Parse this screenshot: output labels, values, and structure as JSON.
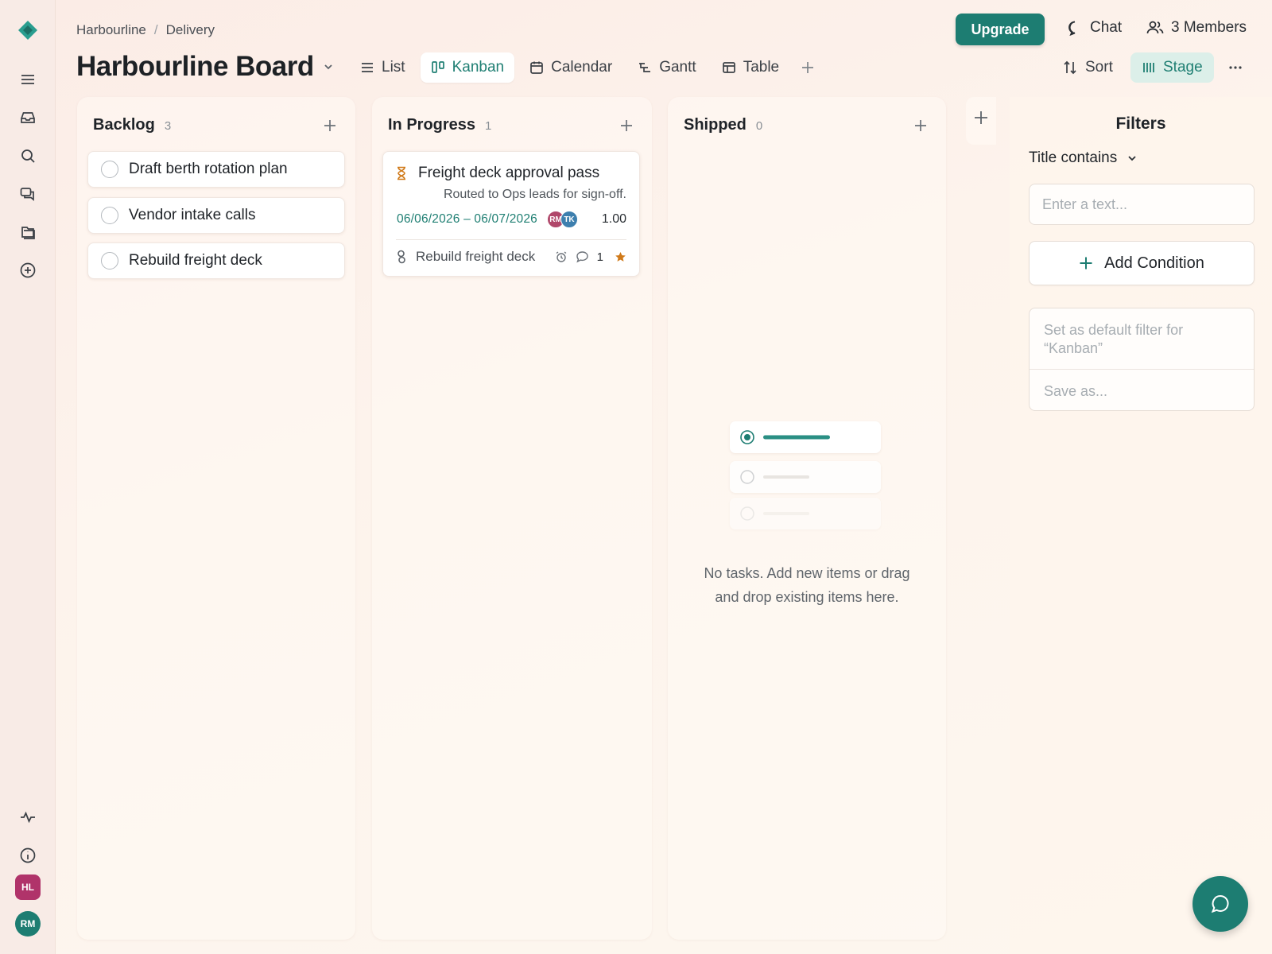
{
  "breadcrumb": {
    "workspace": "Harbourline",
    "separator": "/",
    "page": "Delivery"
  },
  "board": {
    "title": "Harbourline Board"
  },
  "views": [
    {
      "label": "List",
      "icon": "list-icon"
    },
    {
      "label": "Kanban",
      "icon": "kanban-icon",
      "active": true
    },
    {
      "label": "Calendar",
      "icon": "calendar-icon"
    },
    {
      "label": "Gantt",
      "icon": "gantt-icon"
    },
    {
      "label": "Table",
      "icon": "table-icon"
    }
  ],
  "header": {
    "upgrade_label": "Upgrade",
    "chat_label": "Chat",
    "members_label": "3 Members",
    "sort_label": "Sort",
    "stage_label": "Stage"
  },
  "sidebar": {
    "avatars": [
      {
        "initials": "HL",
        "color": "#b0336a"
      },
      {
        "initials": "RM",
        "color": "#1d7d72"
      }
    ]
  },
  "columns": [
    {
      "title": "Backlog",
      "count": "3",
      "tasks": [
        {
          "title": "Draft berth rotation plan"
        },
        {
          "title": "Vendor intake calls"
        },
        {
          "title": "Rebuild freight deck"
        }
      ]
    },
    {
      "title": "In Progress",
      "count": "1",
      "task": {
        "title": "Freight deck approval pass",
        "description": "Routed to Ops leads for sign-off.",
        "date_range": "06/06/2026 – 06/07/2026",
        "assignees": [
          {
            "initials": "RM",
            "color": "#b0476a"
          },
          {
            "initials": "TK",
            "color": "#3d7fae"
          }
        ],
        "estimate": "1.00",
        "parent_title": "Rebuild freight deck",
        "comment_count": "1"
      }
    },
    {
      "title": "Shipped",
      "count": "0",
      "empty_text": "No tasks. Add new items or drag and drop existing items here."
    }
  ],
  "filters": {
    "title": "Filters",
    "field_label": "Title contains",
    "input_placeholder": "Enter a text...",
    "add_condition_label": "Add Condition",
    "set_default_label": "Set as default filter for “Kanban”",
    "save_as_label": "Save as..."
  },
  "colors": {
    "accent": "#1d7d72",
    "brand": "#2a9d8f"
  }
}
